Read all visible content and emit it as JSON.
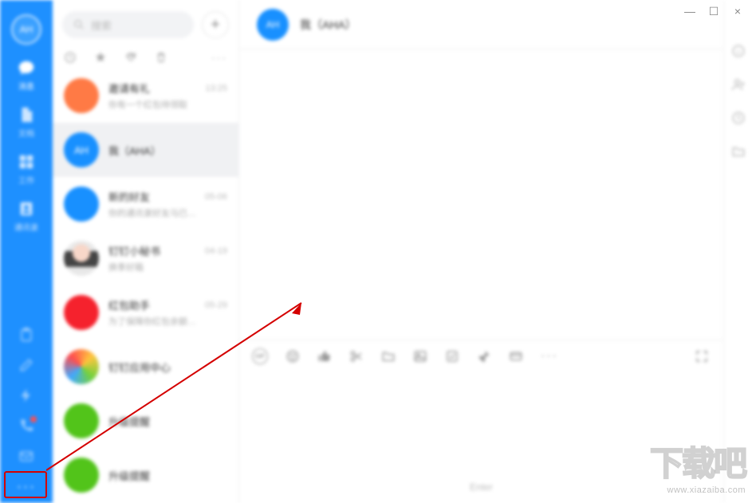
{
  "avatar_initials": "AH",
  "search": {
    "placeholder": "搜索"
  },
  "nav": [
    {
      "label": "消息",
      "key": "messages",
      "active": true
    },
    {
      "label": "文档",
      "key": "docs",
      "active": false
    },
    {
      "label": "工作",
      "key": "work",
      "active": false
    },
    {
      "label": "通讯录",
      "key": "contacts",
      "active": false
    }
  ],
  "more_button": "···",
  "list_tabs": {
    "more": "···"
  },
  "chats": [
    {
      "title": "邀请有礼",
      "preview": "你有一个红包待领取",
      "time": "13:25",
      "avatarClass": "av-orange",
      "selected": false
    },
    {
      "title": "我（AHA）",
      "preview": "",
      "time": "",
      "avatarClass": "av-blue",
      "avatarText": "AH",
      "selected": true
    },
    {
      "title": "新的好友",
      "preview": "你的通讯录好友马已…",
      "time": "05-06",
      "avatarClass": "av-blue",
      "selected": false
    },
    {
      "title": "钉钉小秘书",
      "preview": "换季好箱",
      "time": "04-19",
      "avatarClass": "av-photo",
      "selected": false
    },
    {
      "title": "红包助手",
      "preview": "为了保障你红包余额…",
      "time": "05-29",
      "avatarClass": "av-red",
      "selected": false
    },
    {
      "title": "钉钉应用中心",
      "preview": "",
      "time": "",
      "avatarClass": "av-grad",
      "selected": false
    },
    {
      "title": "升级提醒",
      "preview": "",
      "time": "",
      "avatarClass": "av-green",
      "selected": false
    },
    {
      "title": "升级提醒",
      "preview": "",
      "time": "",
      "avatarClass": "av-green",
      "selected": false
    }
  ],
  "chat_header": {
    "avatar": "AH",
    "title": "我（AHA）"
  },
  "composer": {
    "send_hint": "Enter"
  },
  "toolbar_icons": [
    "gif-icon",
    "emoji-icon",
    "thumbs-up-icon",
    "scissors-icon",
    "folder-icon",
    "image-icon",
    "task-icon",
    "pin-icon",
    "card-icon",
    "more-icon"
  ],
  "watermark_url": "www.xiazaiba.com",
  "watermark_logo": "下载吧",
  "win": {
    "min": "—",
    "max": "☐",
    "close": "×"
  }
}
